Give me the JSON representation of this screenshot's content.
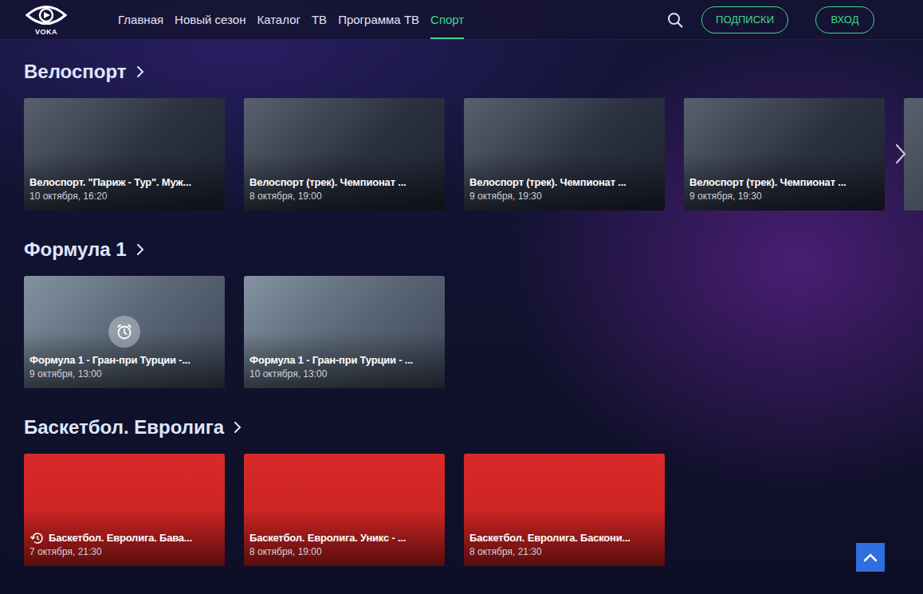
{
  "logo": {
    "text": "VOKA"
  },
  "nav": [
    {
      "label": "Главная",
      "selected": false
    },
    {
      "label": "Новый сезон",
      "selected": false
    },
    {
      "label": "Каталог",
      "selected": false
    },
    {
      "label": "ТВ",
      "selected": false
    },
    {
      "label": "Программа ТВ",
      "selected": false
    },
    {
      "label": "Спорт",
      "selected": true
    }
  ],
  "buttons": [
    {
      "label": "ПОДПИСКИ"
    },
    {
      "label": "ВХОД"
    }
  ],
  "sections": [
    {
      "title": "Велоспорт",
      "cards": [
        {
          "title": "Велоспорт. \"Париж - Тур\". Муж...",
          "date": "10 октября, 16:20",
          "kind": "plain"
        },
        {
          "title": "Велоспорт (трек). Чемпионат ...",
          "date": "8 октября, 19:00",
          "kind": "plain"
        },
        {
          "title": "Велоспорт (трек). Чемпионат ...",
          "date": "9 октября, 19:30",
          "kind": "plain"
        },
        {
          "title": "Велоспорт (трек). Чемпионат ...",
          "date": "9 октября, 19:30",
          "kind": "plain"
        }
      ]
    },
    {
      "title": "Формула 1",
      "cards": [
        {
          "title": "Формула 1 - Гран-при Турции -...",
          "date": "9 октября, 13:00",
          "kind": "reminder"
        },
        {
          "title": "Формула 1 - Гран-при Турции - ...",
          "date": "10 октября, 13:00",
          "kind": "plain"
        }
      ]
    },
    {
      "title": "Баскетбол. Евролига",
      "cards": [
        {
          "title": "Баскетбол. Евролига. Бава...",
          "date": "7 октября, 21:30",
          "kind": "replay"
        },
        {
          "title": "Баскетбол. Евролига. Уникс - ...",
          "date": "8 октября, 19:00",
          "kind": "plain"
        },
        {
          "title": "Баскетбол. Евролига. Баскони...",
          "date": "8 октября, 21:30",
          "kind": "plain"
        }
      ]
    }
  ]
}
